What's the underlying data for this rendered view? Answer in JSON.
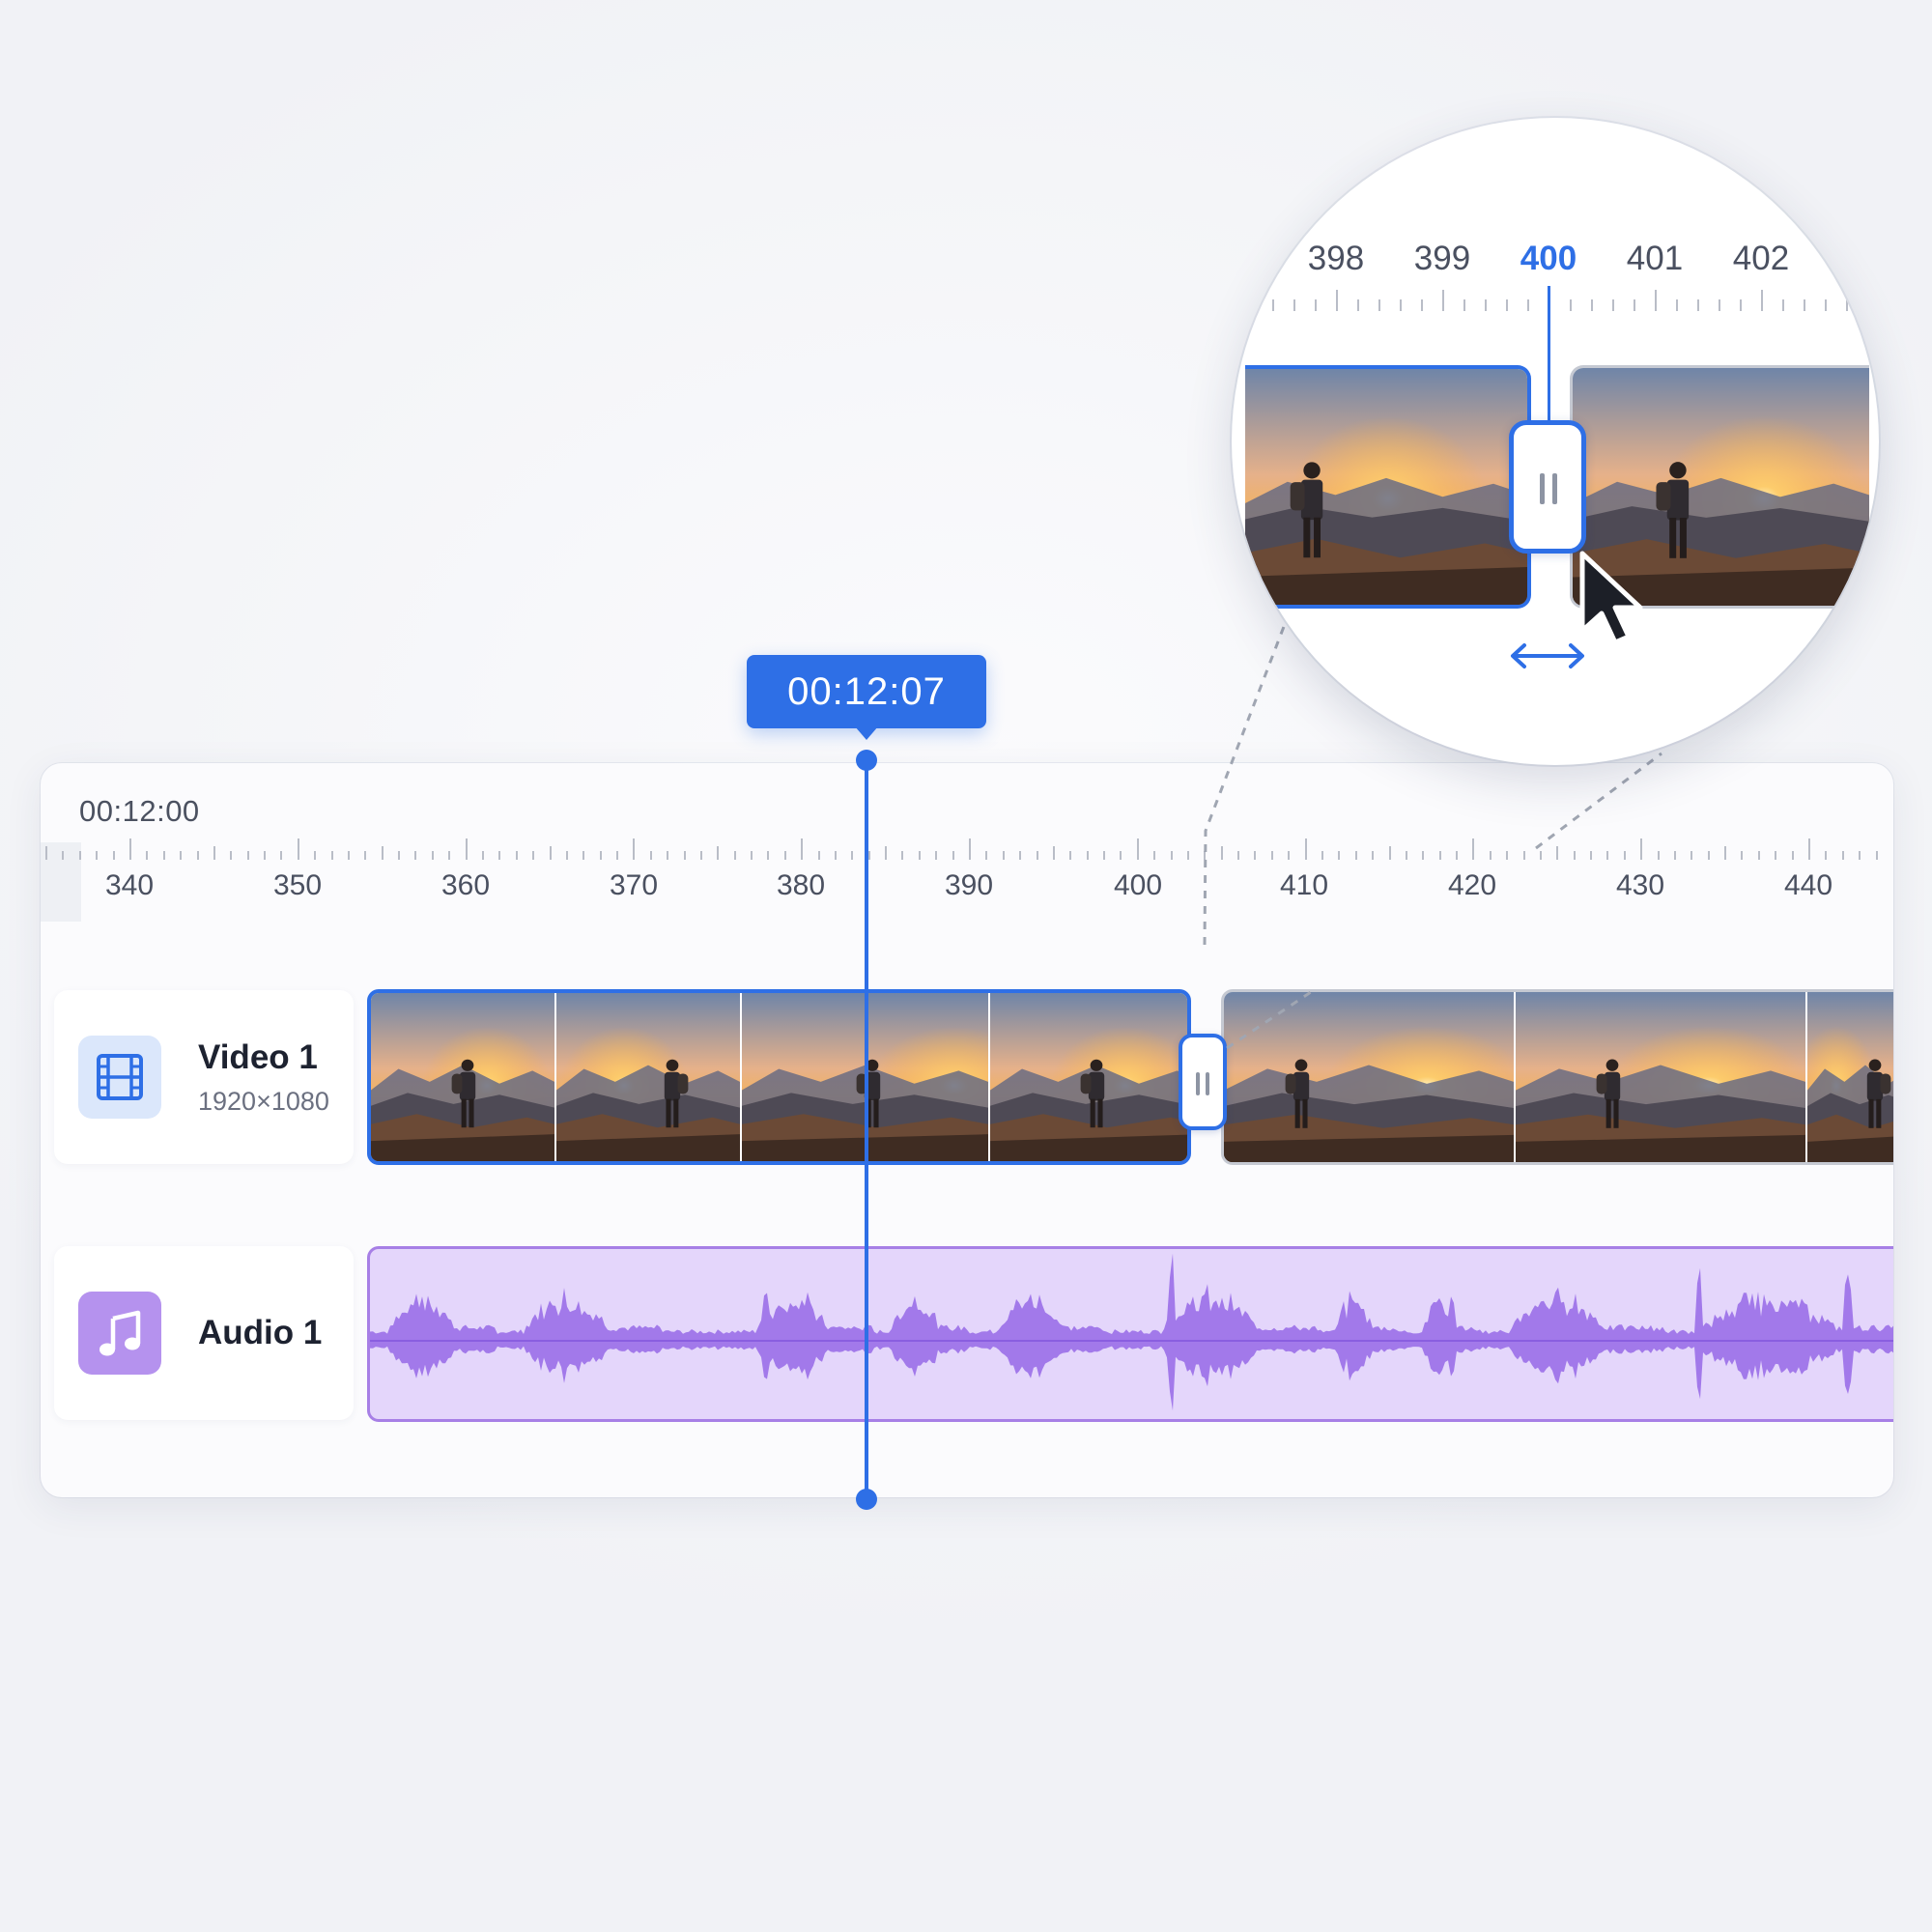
{
  "timeline": {
    "start_time": "00:12:00",
    "ruler_labels": [
      "340",
      "350",
      "360",
      "370",
      "380",
      "390",
      "400",
      "410",
      "420",
      "430",
      "440"
    ]
  },
  "playhead": {
    "timecode": "00:12:07",
    "color": "#2e6fe6"
  },
  "tracks": {
    "video": {
      "name": "Video 1",
      "resolution": "1920×1080",
      "icon": "film-icon",
      "accent": "#2e6fe6"
    },
    "audio": {
      "name": "Audio 1",
      "icon": "music-note-icon",
      "accent": "#a77fe6"
    }
  },
  "magnifier": {
    "labels": [
      "398",
      "399",
      "400",
      "401",
      "402"
    ],
    "active_label": "400",
    "icons": [
      "trim-handle-icon",
      "resize-horizontal-icon",
      "mouse-pointer-icon"
    ]
  }
}
